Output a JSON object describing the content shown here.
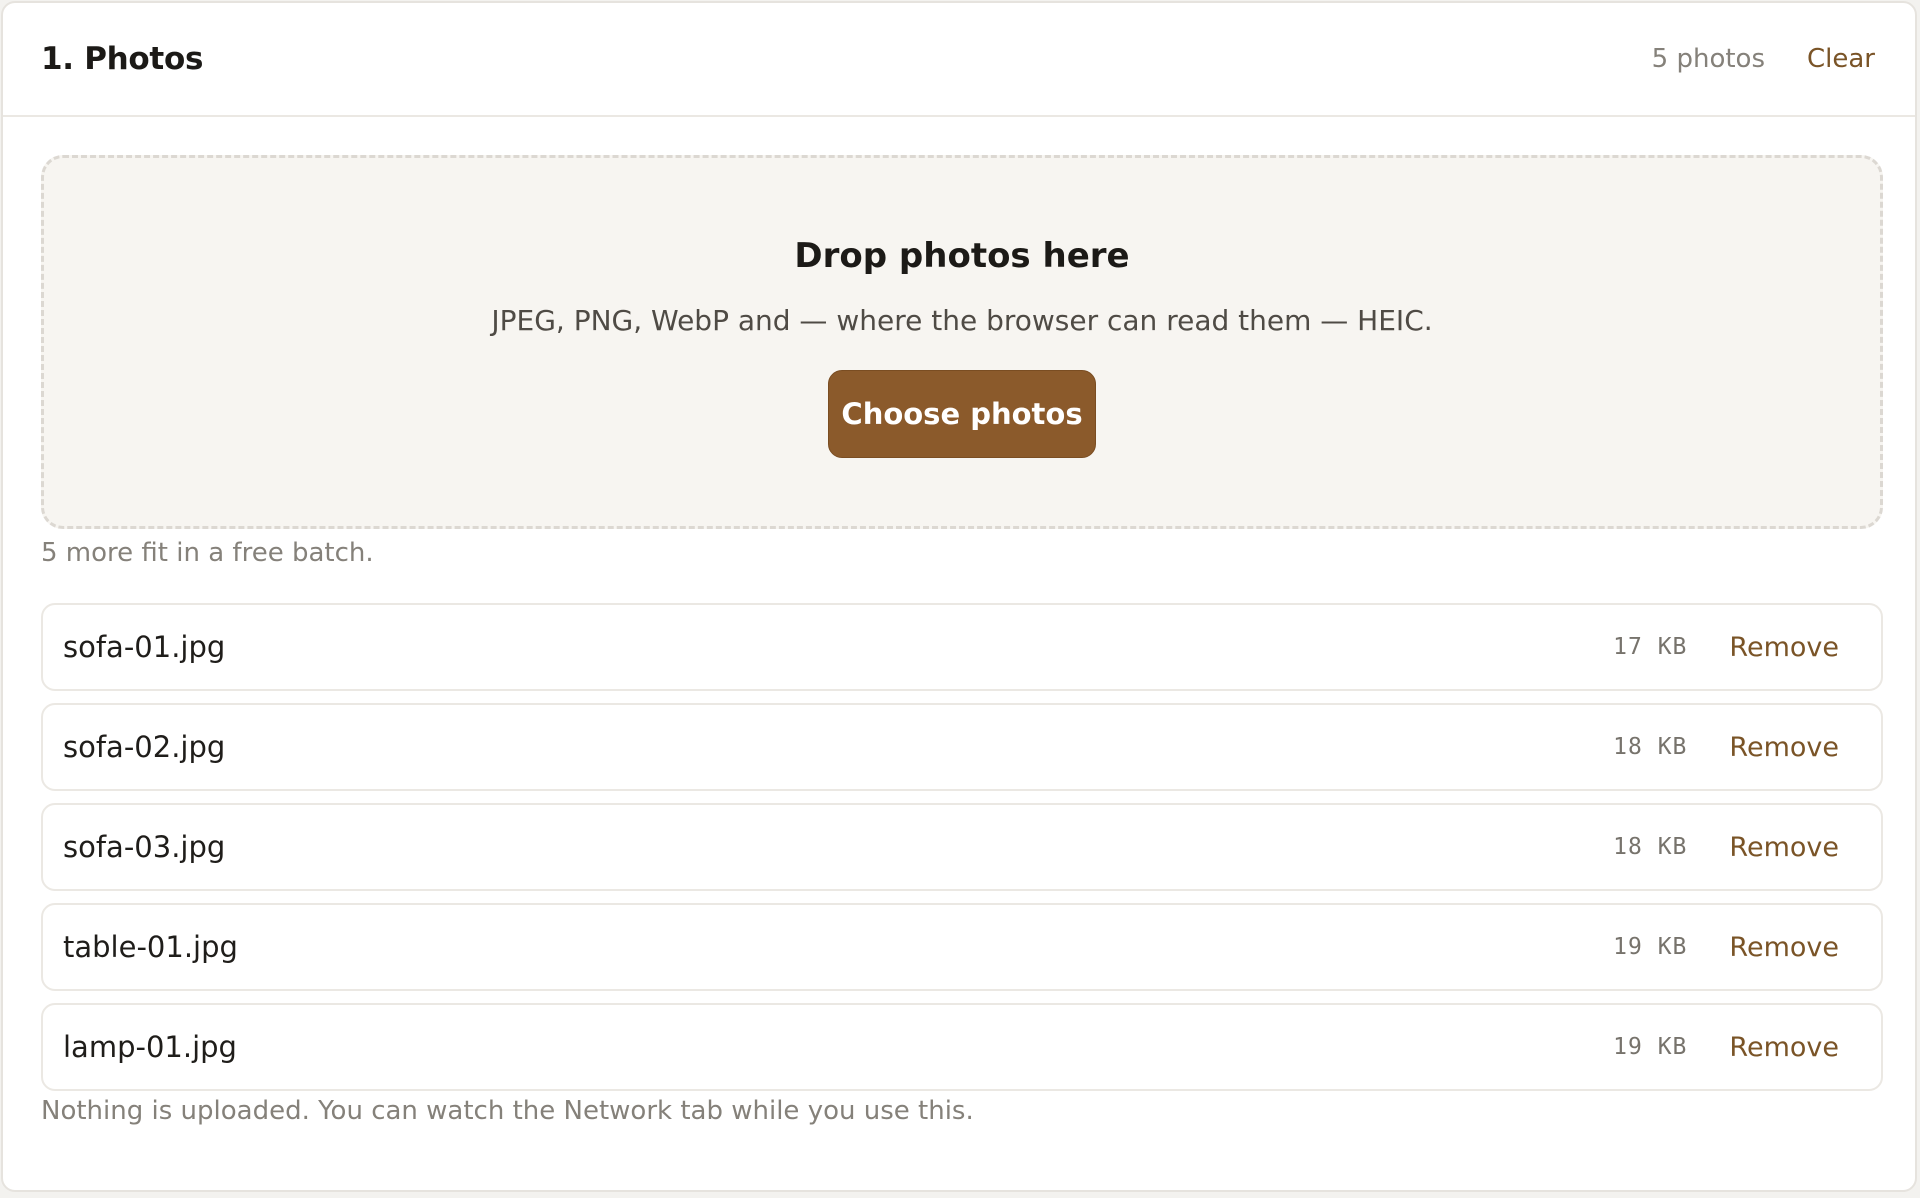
{
  "header": {
    "title": "1. Photos",
    "count_label": "5 photos",
    "clear_label": "Clear"
  },
  "dropzone": {
    "title": "Drop photos here",
    "subtitle": "JPEG, PNG, WebP and — where the browser can read them — HEIC.",
    "button_label": "Choose photos"
  },
  "batch_note": "5 more fit in a free batch.",
  "files": [
    {
      "name": "sofa-01.jpg",
      "size": "17 KB",
      "remove_label": "Remove"
    },
    {
      "name": "sofa-02.jpg",
      "size": "18 KB",
      "remove_label": "Remove"
    },
    {
      "name": "sofa-03.jpg",
      "size": "18 KB",
      "remove_label": "Remove"
    },
    {
      "name": "table-01.jpg",
      "size": "19 KB",
      "remove_label": "Remove"
    },
    {
      "name": "lamp-01.jpg",
      "size": "19 KB",
      "remove_label": "Remove"
    }
  ],
  "footer_note": "Nothing is uploaded. You can watch the Network tab while you use this.",
  "colors": {
    "accent": "#8b5a2b",
    "link": "#7a5427",
    "muted_text": "#85817a",
    "dropzone_bg": "#f7f5f1"
  }
}
